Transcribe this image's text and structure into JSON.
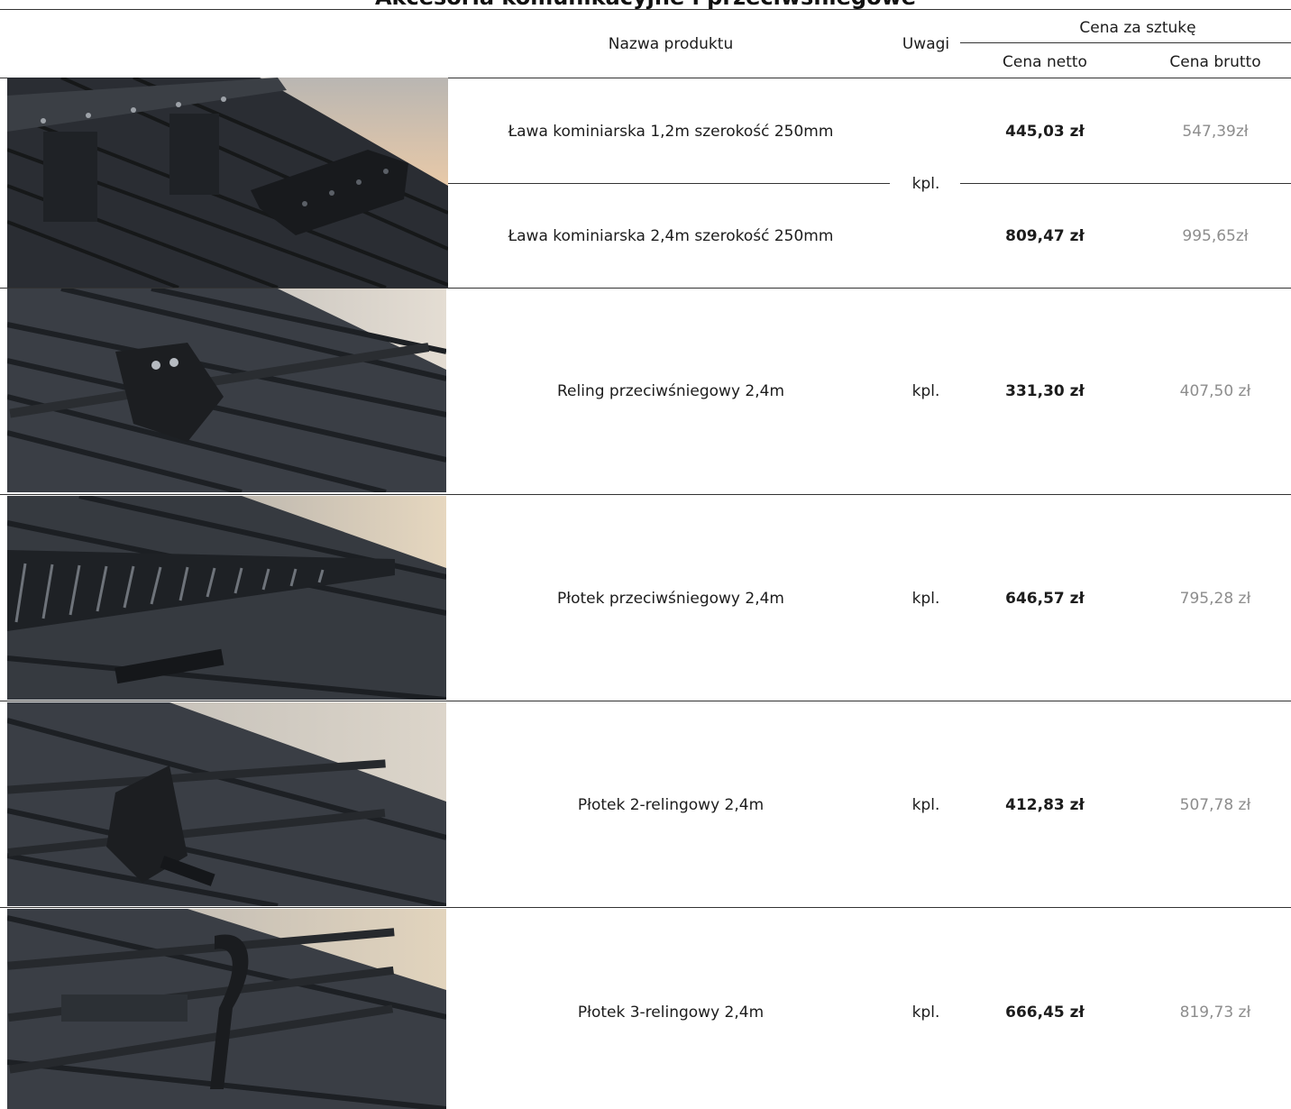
{
  "title_fragment": "Akcesoria komunikacyjne i przeciwśniegowe",
  "header": {
    "product_name": "Nazwa produktu",
    "remarks": "Uwagi",
    "price_per_piece": "Cena za sztukę",
    "net_price": "Cena netto",
    "gross_price": "Cena brutto"
  },
  "rows": [
    {
      "name": "Ława kominiarska 1,2m szerokość 250mm",
      "unit": "kpl.",
      "net": "445,03 zł",
      "gross": "547,39zł"
    },
    {
      "name": "Ława kominiarska 2,4m szerokość 250mm",
      "unit": "kpl.",
      "net": "809,47 zł",
      "gross": "995,65zł"
    },
    {
      "name": "Reling przeciwśniegowy 2,4m",
      "unit": "kpl.",
      "net": "331,30 zł",
      "gross": "407,50 zł"
    },
    {
      "name": "Płotek przeciwśniegowy 2,4m",
      "unit": "kpl.",
      "net": "646,57 zł",
      "gross": "795,28 zł"
    },
    {
      "name": "Płotek 2-relingowy 2,4m",
      "unit": "kpl.",
      "net": "412,83 zł",
      "gross": "507,78 zł"
    },
    {
      "name": "Płotek 3-relingowy 2,4m",
      "unit": "kpl.",
      "net": "666,45 zł",
      "gross": "819,73 zł"
    }
  ],
  "photos": [
    {
      "icon": "chimney-bench-photo"
    },
    {
      "icon": "snow-rail-photo"
    },
    {
      "icon": "snow-fence-photo"
    },
    {
      "icon": "two-rail-fence-photo"
    },
    {
      "icon": "three-rail-fence-photo"
    }
  ],
  "colors": {
    "roof_dark": "#24272c",
    "roof_light": "#4a4f57",
    "sky": "#cfc9c0",
    "gross_text": "#8d8d8d"
  }
}
